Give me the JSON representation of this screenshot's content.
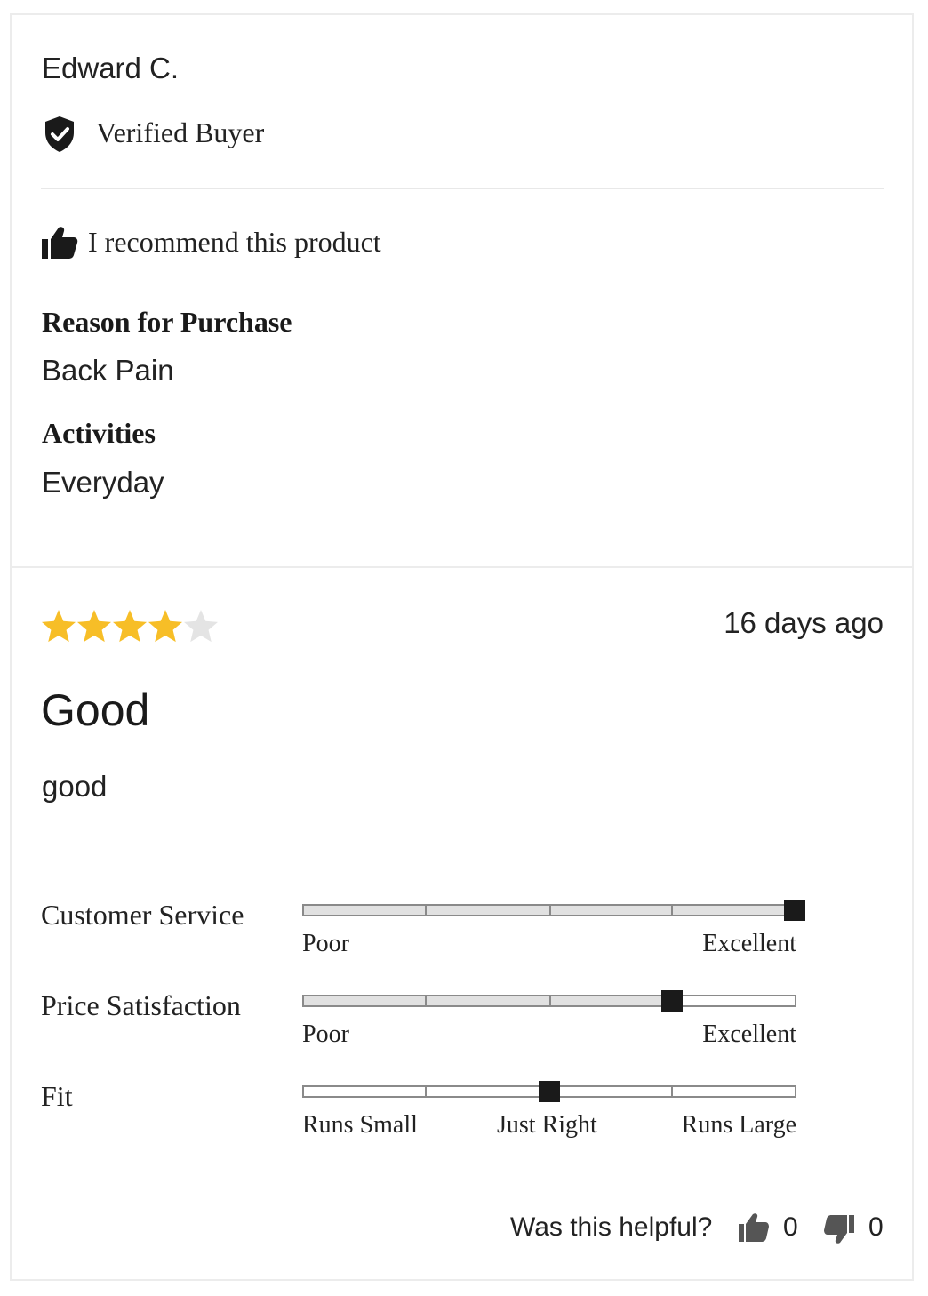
{
  "reviewer": {
    "name": "Edward C.",
    "badge": "Verified Buyer"
  },
  "recommendation": "I recommend this product",
  "details": [
    {
      "label": "Reason for Purchase",
      "value": "Back Pain"
    },
    {
      "label": "Activities",
      "value": "Everyday"
    }
  ],
  "review": {
    "rating": 4,
    "max_rating": 5,
    "date": "16 days ago",
    "title": "Good",
    "body": "good"
  },
  "sliders": [
    {
      "label": "Customer Service",
      "value_fraction": 1.0,
      "scale": [
        "Poor",
        "Excellent"
      ]
    },
    {
      "label": "Price Satisfaction",
      "value_fraction": 0.75,
      "scale": [
        "Poor",
        "Excellent"
      ]
    },
    {
      "label": "Fit",
      "value_fraction": 0.5,
      "scale": [
        "Runs Small",
        "Just Right",
        "Runs Large"
      ]
    }
  ],
  "helpful": {
    "prompt": "Was this helpful?",
    "up_count": "0",
    "down_count": "0"
  },
  "colors": {
    "star_filled": "#F7BE27",
    "star_empty": "#E4E4E4",
    "handle": "#1A1A1A",
    "track_fill": "#E1E1E1"
  }
}
